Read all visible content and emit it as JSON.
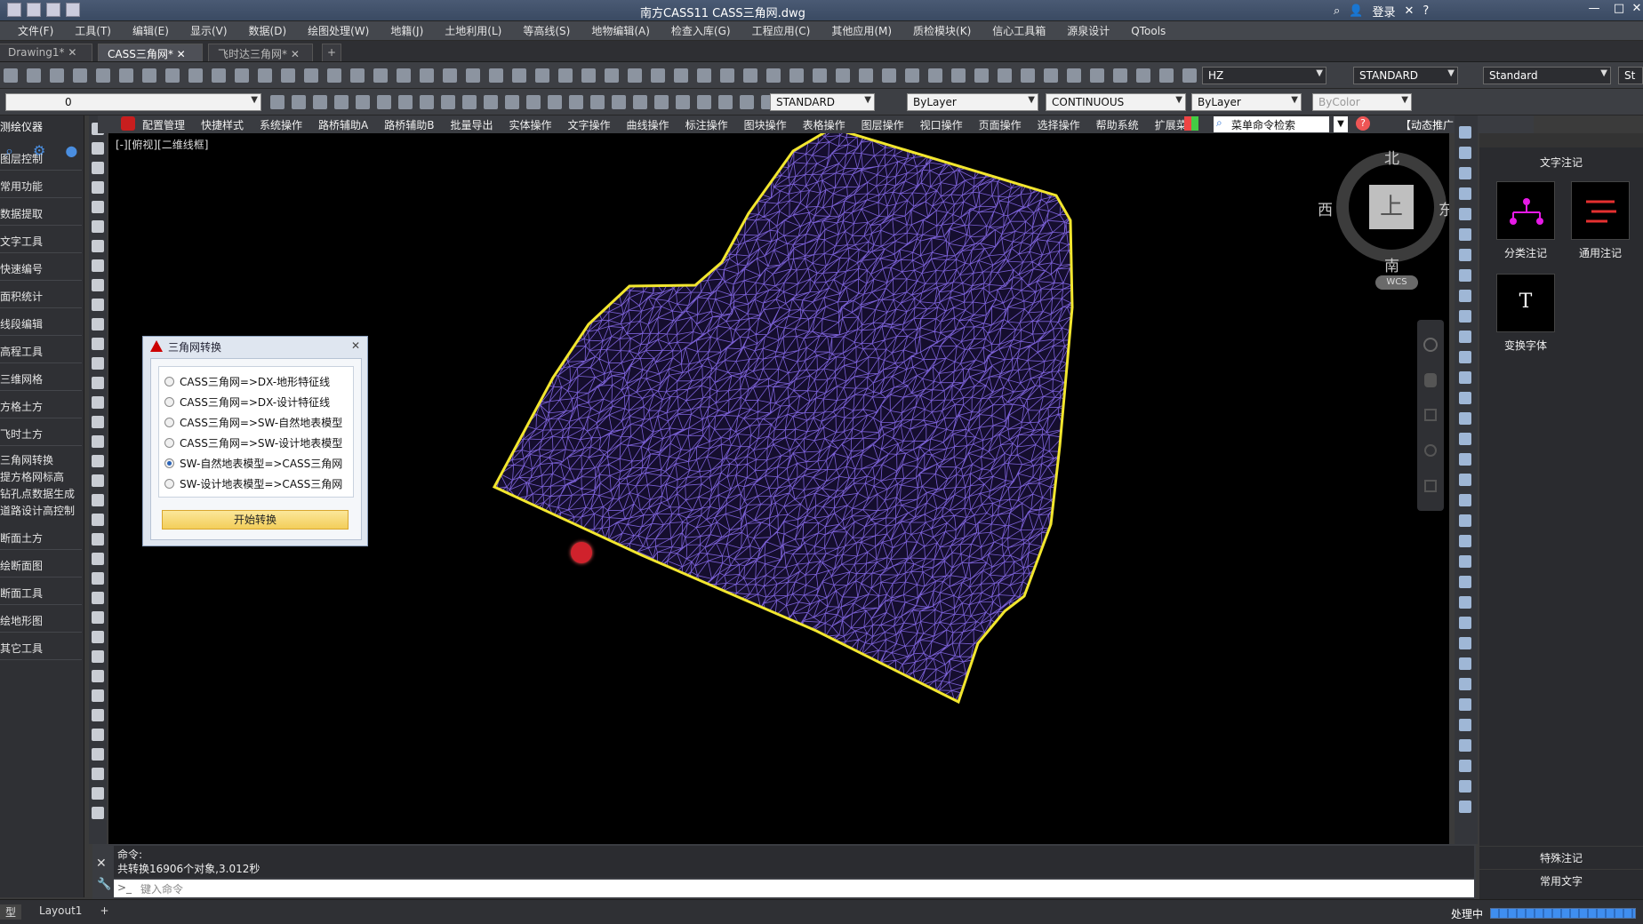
{
  "window": {
    "title": "南方CASS11    CASS三角网.dwg",
    "login": "登录"
  },
  "menubar": [
    "文件(F)",
    "工具(T)",
    "编辑(E)",
    "显示(V)",
    "数据(D)",
    "绘图处理(W)",
    "地籍(J)",
    "土地利用(L)",
    "等高线(S)",
    "地物编辑(A)",
    "检查入库(G)",
    "工程应用(C)",
    "其他应用(M)",
    "质检模块(K)",
    "信心工具箱",
    "源泉设计",
    "QTools"
  ],
  "doctabs": [
    {
      "label": "Drawing1*",
      "active": false
    },
    {
      "label": "CASS三角网*",
      "active": true
    },
    {
      "label": "飞时达三角网*",
      "active": false
    }
  ],
  "toolbar": {
    "layer_value": "0",
    "hz": "HZ",
    "textstyle": "STANDARD",
    "dimstyle": "Standard",
    "standard2": "STANDARD",
    "color": "ByLayer",
    "linetype": "CONTINUOUS",
    "lineweight": "ByLayer",
    "plotstyle": "ByColor",
    "partial_right": "St"
  },
  "menubar2": [
    "配置管理",
    "快捷样式",
    "系统操作",
    "路桥辅助A",
    "路桥辅助B",
    "批量导出",
    "实体操作",
    "文字操作",
    "曲线操作",
    "标注操作",
    "图块操作",
    "表格操作",
    "图层操作",
    "视口操作",
    "页面操作",
    "选择操作",
    "帮助系统",
    "扩展菜单"
  ],
  "search_label": "菜单命令检索",
  "dynamic_label": "【动态推广",
  "leftpanel": {
    "title": "测绘仪器",
    "items": [
      "图层控制",
      "常用功能",
      "数据提取",
      "文字工具",
      "快速编号",
      "面积统计",
      "线段编辑",
      "高程工具",
      "三维网格",
      "方格土方",
      "飞时土方"
    ],
    "subitems": [
      "三角网转换",
      "提方格网标高",
      "钻孔点数据生成",
      "道路设计高控制"
    ],
    "items2": [
      "断面土方",
      "绘断面图",
      "断面工具",
      "绘地形图",
      "其它工具"
    ]
  },
  "viewport_label": "[-][俯视][二维线框]",
  "compass": {
    "north": "北",
    "south": "南",
    "east": "东",
    "west": "西",
    "top": "上",
    "wcs": "WCS"
  },
  "dialog": {
    "title": "三角网转换",
    "options": [
      {
        "label": "CASS三角网=>DX-地形特征线",
        "selected": false
      },
      {
        "label": "CASS三角网=>DX-设计特征线",
        "selected": false
      },
      {
        "label": "CASS三角网=>SW-自然地表模型",
        "selected": false
      },
      {
        "label": "CASS三角网=>SW-设计地表模型",
        "selected": false
      },
      {
        "label": "SW-自然地表模型=>CASS三角网",
        "selected": true
      },
      {
        "label": "SW-设计地表模型=>CASS三角网",
        "selected": false
      }
    ],
    "button": "开始转换"
  },
  "rightpanel": {
    "title": "文字注记",
    "tiles": [
      "分类注记",
      "通用注记",
      "变换字体"
    ],
    "bottom": [
      "特殊注记",
      "常用文字"
    ]
  },
  "command": {
    "line1": "命令:",
    "line2": "共转换16906个对象,3.012秒",
    "placeholder": "键入命令"
  },
  "statusbar": {
    "tabs": [
      "型",
      "Layout1",
      "+"
    ],
    "processing": "处理中"
  },
  "colors": {
    "tin": "#7b61d6",
    "boundary": "#f2e62e",
    "drawing_bg": "#000000"
  }
}
